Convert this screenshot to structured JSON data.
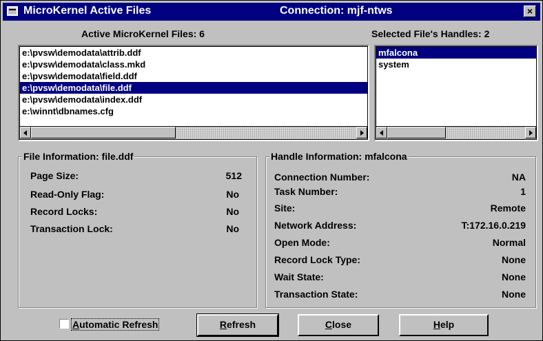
{
  "window": {
    "title": "MicroKernel Active Files",
    "connection": "Connection: mjf-ntws",
    "close_glyph": "×"
  },
  "files_panel": {
    "label": "Active MicroKernel Files:  6",
    "items": [
      "e:\\pvsw\\demodata\\attrib.ddf",
      "e:\\pvsw\\demodata\\class.mkd",
      "e:\\pvsw\\demodata\\field.ddf",
      "e:\\pvsw\\demodata\\file.ddf",
      "e:\\pvsw\\demodata\\index.ddf",
      "e:\\winnt\\dbnames.cfg"
    ],
    "selected_index": 3
  },
  "handles_panel": {
    "label": "Selected File's Handles: 2",
    "items": [
      "mfalcona",
      "system"
    ],
    "selected_index": 0
  },
  "file_info": {
    "title": "File Information: file.ddf",
    "rows": [
      {
        "label": "Page Size:",
        "value": "512"
      },
      {
        "label": "Read-Only Flag:",
        "value": "No"
      },
      {
        "label": "Record Locks:",
        "value": "No"
      },
      {
        "label": "Transaction Lock:",
        "value": "No"
      }
    ]
  },
  "handle_info": {
    "title": "Handle Information: mfalcona",
    "rows": [
      {
        "label": "Connection Number:",
        "value": "NA"
      },
      {
        "label": "Task Number:",
        "value": "1"
      },
      {
        "label": "Site:",
        "value": "Remote"
      },
      {
        "label": "Network Address:",
        "value": "T:172.16.0.219"
      },
      {
        "label": "Open Mode:",
        "value": "Normal"
      },
      {
        "label": "Record Lock Type:",
        "value": "None"
      },
      {
        "label": "Wait State:",
        "value": "None"
      },
      {
        "label": "Transaction State:",
        "value": "None"
      }
    ]
  },
  "footer": {
    "auto_refresh": {
      "first": "A",
      "rest": "utomatic Refresh",
      "checked": false
    },
    "refresh": {
      "first": "R",
      "rest": "efresh"
    },
    "close": {
      "first": "C",
      "rest": "lose"
    },
    "help": {
      "first": "H",
      "rest": "elp"
    }
  },
  "colors": {
    "face": "#c0c0c0",
    "selection": "#000080",
    "title_bar": "#000080"
  }
}
